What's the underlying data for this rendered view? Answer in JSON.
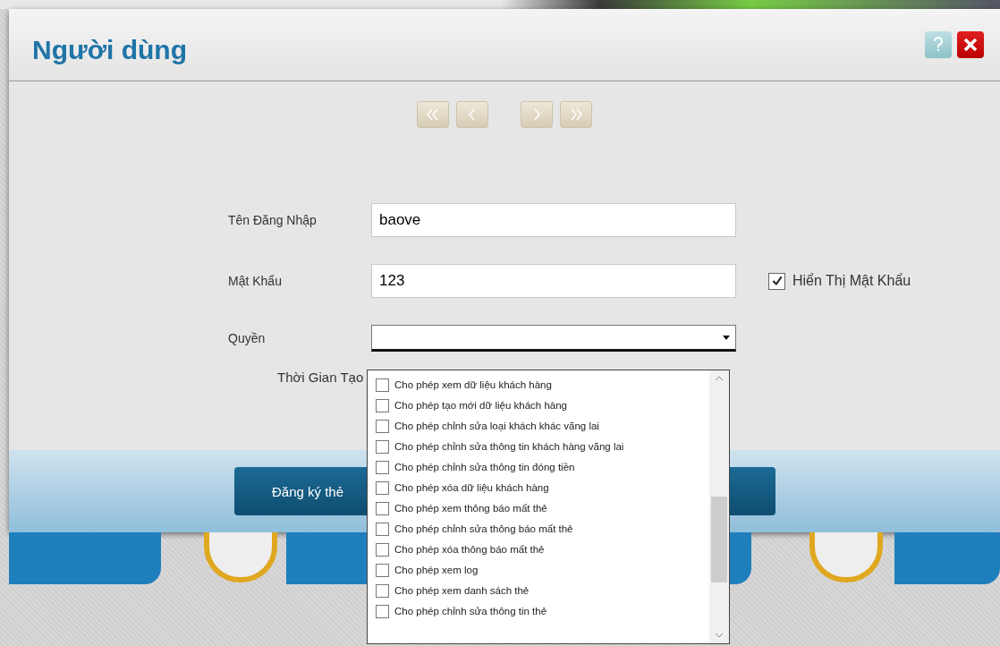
{
  "window": {
    "title": "Người dùng"
  },
  "fields": [
    {
      "label": "Tên Đăng Nhập",
      "value": "baove",
      "kind": "text"
    },
    {
      "label": "Mật Khẩu",
      "value": "123",
      "kind": "text"
    },
    {
      "label": "Quyền",
      "kind": "dropdown",
      "expanded": true
    }
  ],
  "show_password": {
    "label": "Hiển Thị Mật Khẩu",
    "checked": true
  },
  "created_time": {
    "label": "Thời Gian Tạo"
  },
  "register_button": {
    "label": "Đăng ký thẻ"
  },
  "permissions": [
    {
      "label": "Cho phép xem dữ liệu khách hàng",
      "checked": false
    },
    {
      "label": "Cho phép tạo mới dữ liệu khách hàng",
      "checked": false
    },
    {
      "label": "Cho phép chỉnh sửa loại khách khác vãng lai",
      "checked": false
    },
    {
      "label": "Cho phép chỉnh sửa thông tin khách hàng vãng lai",
      "checked": false
    },
    {
      "label": "Cho phép chỉnh sửa thông tin đóng tiền",
      "checked": false
    },
    {
      "label": "Cho phép xóa dữ liệu khách hàng",
      "checked": false
    },
    {
      "label": "Cho phép xem thông báo mất thẻ",
      "checked": false
    },
    {
      "label": "Cho phép chỉnh sửa thông báo mất thẻ",
      "checked": false
    },
    {
      "label": "Cho phép xóa thông báo mất thẻ",
      "checked": false
    },
    {
      "label": "Cho phép xem log",
      "checked": false
    },
    {
      "label": "Cho phép xem danh sách thẻ",
      "checked": false
    },
    {
      "label": "Cho phép chỉnh sửa thông tin thẻ",
      "checked": false
    }
  ]
}
